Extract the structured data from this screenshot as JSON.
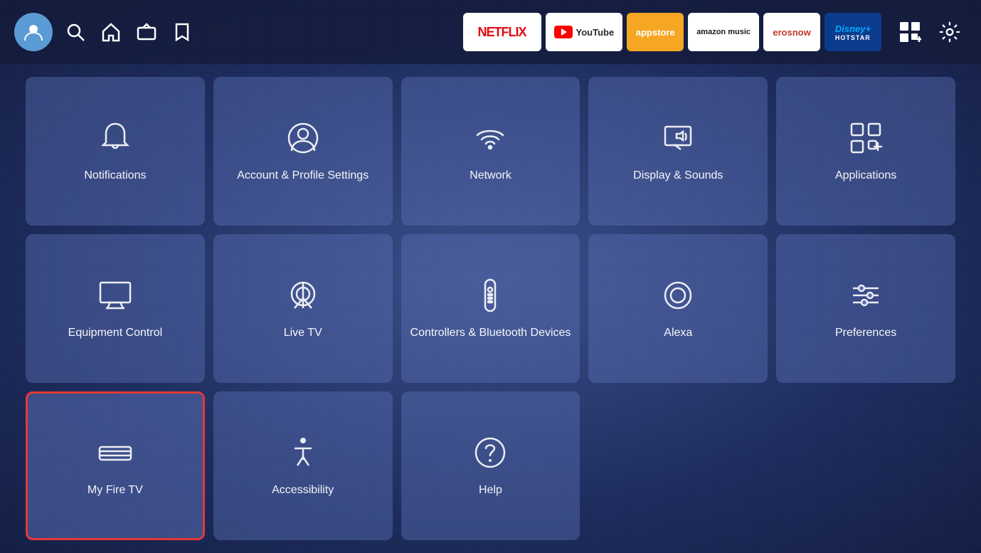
{
  "topbar": {
    "avatar_label": "User Profile",
    "nav_items": [
      {
        "name": "search",
        "label": "Search"
      },
      {
        "name": "home",
        "label": "Home"
      },
      {
        "name": "live-tv",
        "label": "Live TV"
      },
      {
        "name": "watchlist",
        "label": "Watchlist"
      }
    ],
    "apps": [
      {
        "id": "netflix",
        "label": "NETFLIX",
        "class": "netflix"
      },
      {
        "id": "youtube",
        "label": "YouTube",
        "class": "youtube"
      },
      {
        "id": "appstore",
        "label": "appstore",
        "class": "appstore"
      },
      {
        "id": "amazon-music",
        "label": "amazon music",
        "class": "amazon-music"
      },
      {
        "id": "erosnow",
        "label": "erosnow",
        "class": "erosnow"
      },
      {
        "id": "disney",
        "label": "Disney+ Hotstar",
        "class": "disney"
      }
    ],
    "right_icons": [
      {
        "name": "grid-icon",
        "label": "App Grid"
      },
      {
        "name": "settings-icon",
        "label": "Settings"
      }
    ]
  },
  "grid": {
    "items": [
      {
        "id": "notifications",
        "label": "Notifications",
        "icon": "bell",
        "selected": false
      },
      {
        "id": "account-profile",
        "label": "Account & Profile Settings",
        "icon": "person-circle",
        "selected": false
      },
      {
        "id": "network",
        "label": "Network",
        "icon": "wifi",
        "selected": false
      },
      {
        "id": "display-sounds",
        "label": "Display & Sounds",
        "icon": "display-sound",
        "selected": false
      },
      {
        "id": "applications",
        "label": "Applications",
        "icon": "apps-grid",
        "selected": false
      },
      {
        "id": "equipment-control",
        "label": "Equipment Control",
        "icon": "monitor",
        "selected": false
      },
      {
        "id": "live-tv",
        "label": "Live TV",
        "icon": "antenna",
        "selected": false
      },
      {
        "id": "controllers-bluetooth",
        "label": "Controllers & Bluetooth Devices",
        "icon": "remote",
        "selected": false
      },
      {
        "id": "alexa",
        "label": "Alexa",
        "icon": "alexa",
        "selected": false
      },
      {
        "id": "preferences",
        "label": "Preferences",
        "icon": "sliders",
        "selected": false
      },
      {
        "id": "my-fire-tv",
        "label": "My Fire TV",
        "icon": "fire-tv",
        "selected": true
      },
      {
        "id": "accessibility",
        "label": "Accessibility",
        "icon": "accessibility",
        "selected": false
      },
      {
        "id": "help",
        "label": "Help",
        "icon": "help-circle",
        "selected": false
      }
    ]
  }
}
